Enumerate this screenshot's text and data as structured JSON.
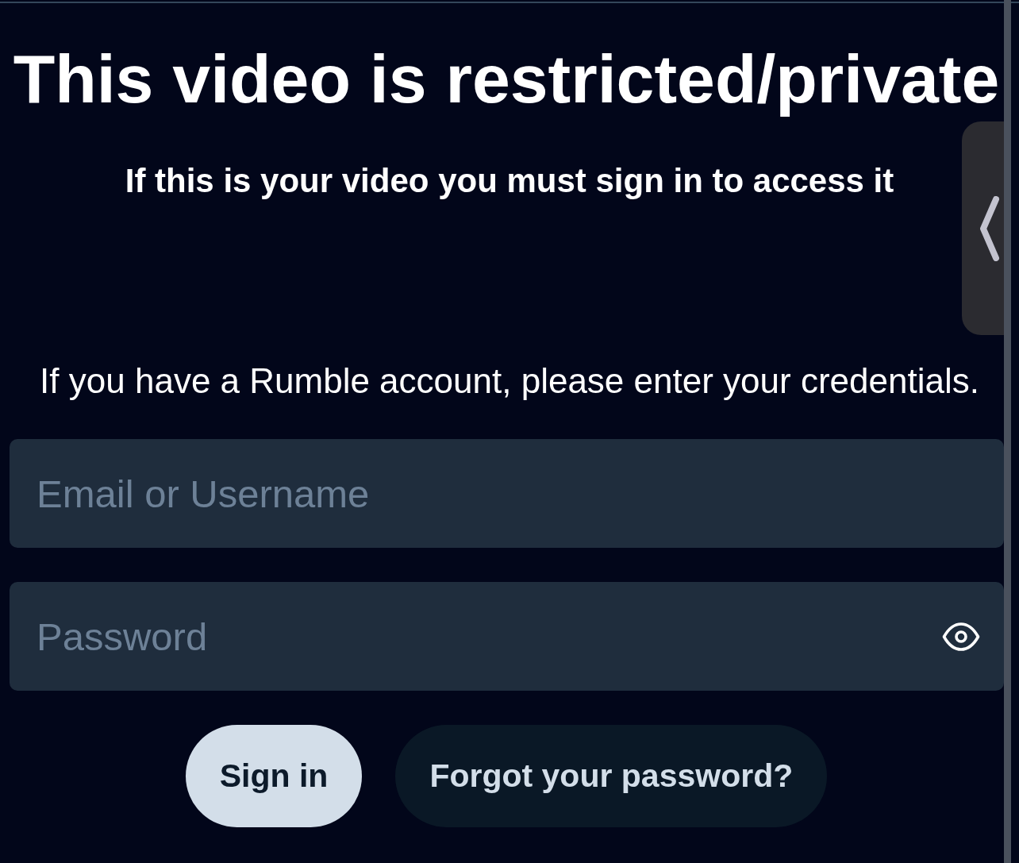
{
  "heading": "This video is restricted/private",
  "subheading": "If this is your video you must sign in to access it",
  "instructions": "If you have a Rumble account, please enter your credentials.",
  "fields": [
    {
      "kind": "text",
      "placeholder": "Email or Username"
    },
    {
      "kind": "password",
      "placeholder": "Password"
    }
  ],
  "buttons": [
    {
      "kind": "primary",
      "label": "Sign in"
    },
    {
      "kind": "secondary",
      "label": "Forgot your password?"
    }
  ]
}
